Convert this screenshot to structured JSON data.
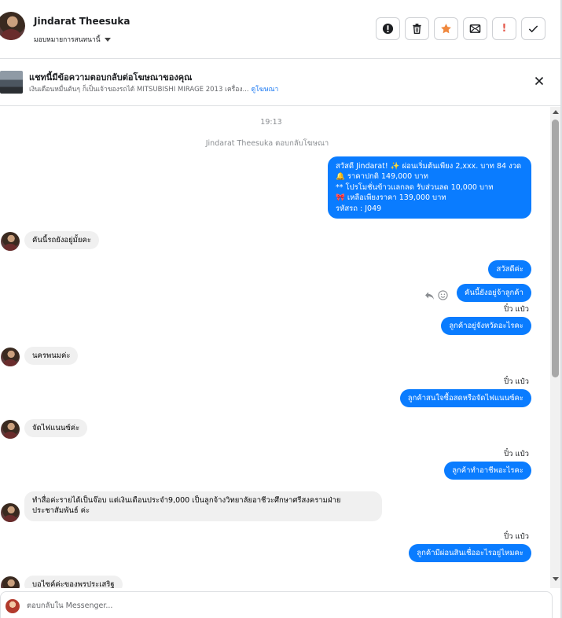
{
  "header": {
    "contact_name": "Jindarat Theesuka",
    "assign_label": "มอบหมายการสนทนานี้",
    "actions": [
      {
        "name": "report-icon"
      },
      {
        "name": "trash-icon"
      },
      {
        "name": "star-icon",
        "color": "#f0883e"
      },
      {
        "name": "mark-unread-icon"
      },
      {
        "name": "spam-icon",
        "label": "!"
      },
      {
        "name": "done-check-icon"
      }
    ]
  },
  "ad": {
    "title": "แชทนี้มีข้อความตอบกลับต่อโฆษณาของคุณ",
    "subtitle": "เงินเดือนหมื่นต้นๆ ก็เป็นเจ้าของรถได้ MITSUBISHI MIRAGE 2013 เครื่อง...",
    "link": "ดูโฆษณา"
  },
  "thread": {
    "time": "19:13",
    "system_line": "Jindarat Theesuka ตอบกลับโฆษณา",
    "ad_reply_lines": [
      "สวัสดี Jindarat! ✨  ผ่อนเริ่มต้นเพียง 2,xxx. บาท 84 งวด",
      "🔔 ราคาปกติ 149,000 บาท",
      "** โปรโมชั่นข้าวแลกลด รับส่วนลด 10,000 บาท",
      "🎀  เหลือเพียงราคา 139,000 บาท",
      " รหัสรถ : J049"
    ],
    "messages": [
      {
        "text": "คันนี้รถยังอยู่มั้ยคะ"
      },
      {
        "text": "สวัสดีค่ะ"
      },
      {
        "text": "คันนี้ยังอยู่จ้าลูกค้า"
      },
      {
        "sender": "ปิ๋ว แป๋ว",
        "text": "ลูกค้าอยู่จังหวัดอะไรคะ"
      },
      {
        "text": "นครพนมค่ะ"
      },
      {
        "sender": "ปิ๋ว แป๋ว",
        "text": "ลูกค้าสนใจซื้อสดหรือจัดไฟแนนซ์คะ"
      },
      {
        "text": "จัดไฟแนนซ์ค่ะ"
      },
      {
        "sender": "ปิ๋ว แป๋ว",
        "text": "ลูกค้าทำอาชีพอะไรคะ"
      },
      {
        "text": "ทำสื่อค่ะรายได้เป็นจ๊อบ แต่เงินเดือนประจำ9,000 เป็นลูกจ้างวิทยาลัยอาชีวะศึกษาศรีสงครามฝ่ายประชาสัมพันธ์ ค่ะ"
      },
      {
        "sender": "ปิ๋ว แป๋ว",
        "text": "ลูกค้ามีผ่อนสินเชื่ออะไรอยู่ไหมคะ"
      },
      {
        "text": "บอไซค์ค่ะของพรประเสริฐ"
      }
    ]
  },
  "composer": {
    "placeholder": "ตอบกลับใน Messenger..."
  },
  "colors": {
    "outgoing_bubble": "#0a7cff",
    "incoming_bubble": "#f0f0f0",
    "star": "#f0883e",
    "spam": "#e4584b"
  }
}
